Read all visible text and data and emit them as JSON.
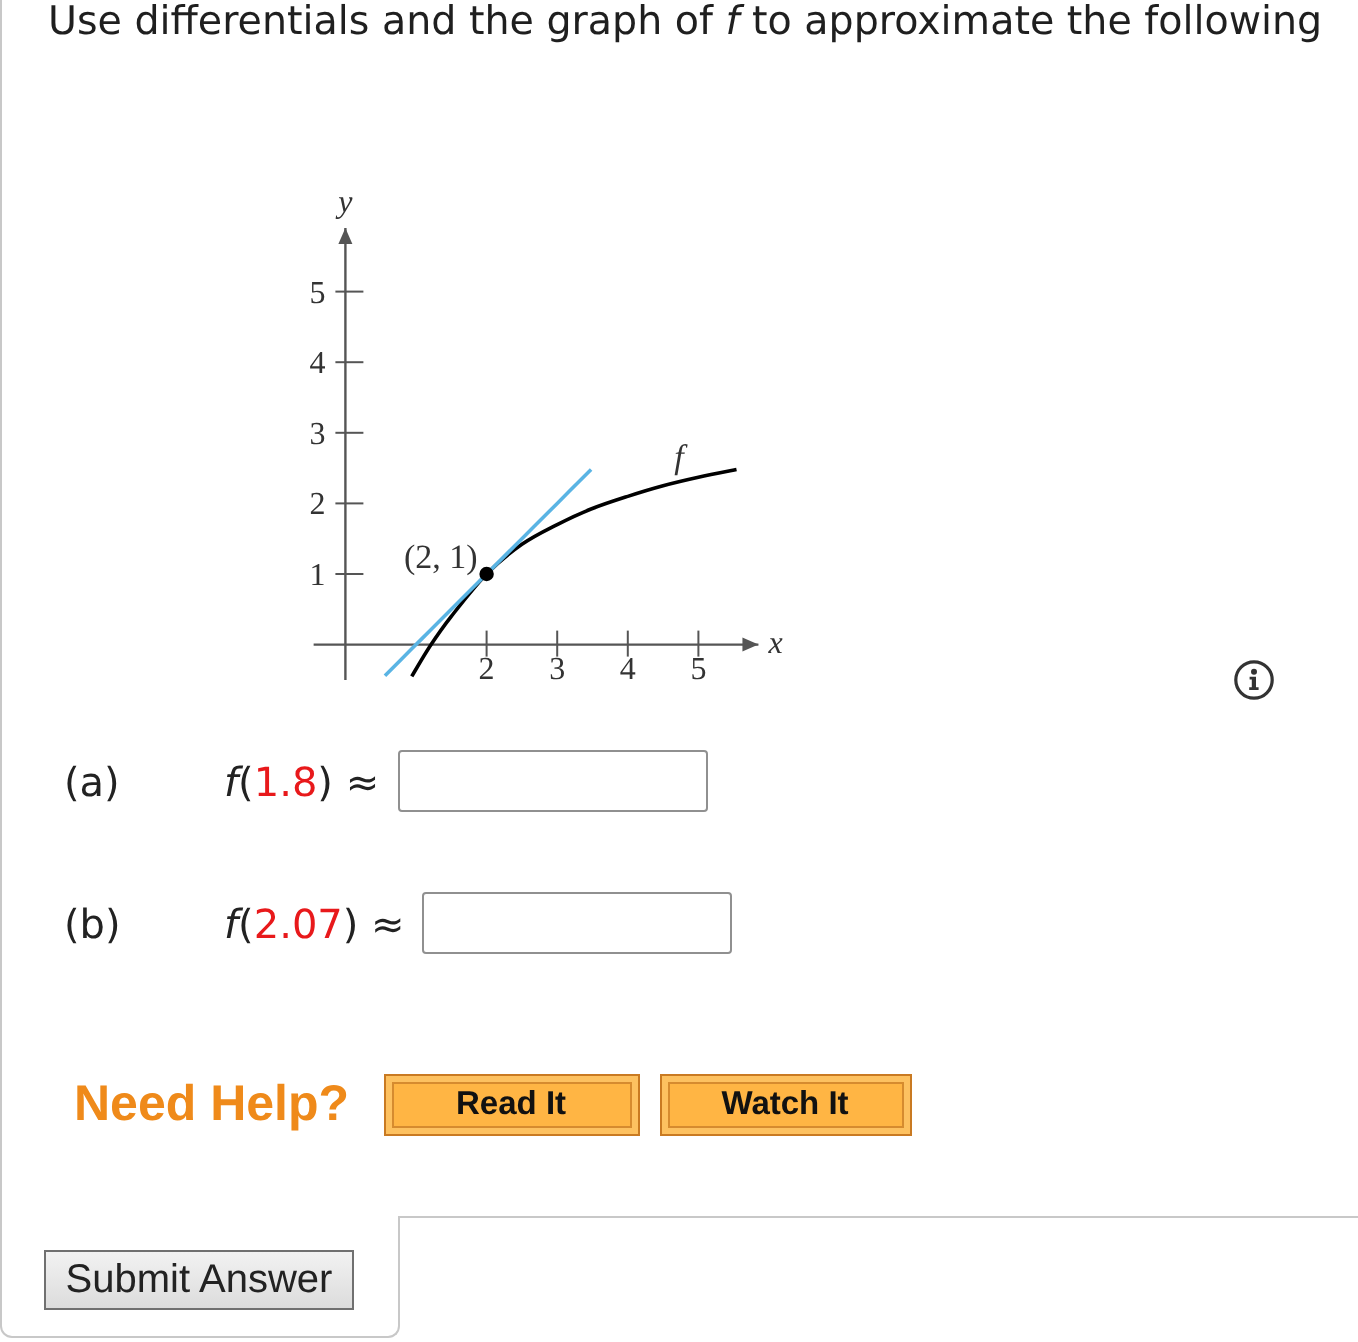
{
  "question": {
    "prompt": "Use differentials and the graph of *f* to approximate the following"
  },
  "figure": {
    "chart_data": {
      "type": "line",
      "xlabel": "x",
      "ylabel": "y",
      "x": [
        0.56,
        0.94,
        1.2,
        1.5,
        2,
        2.5,
        3,
        3.48,
        4,
        4.5,
        5,
        5.54
      ],
      "series": [
        {
          "color": "#000000",
          "values": [
            null,
            -0.45,
            -0.02,
            0.4,
            1,
            1.42,
            1.7,
            1.92,
            2.1,
            2.25,
            2.37,
            2.48
          ]
        },
        {
          "color": "#5ab4e4",
          "values": [
            -0.44,
            -0.06,
            0.2,
            0.5,
            1,
            1.5,
            2,
            2.48,
            null,
            null,
            null,
            null
          ]
        }
      ],
      "xlim": [
        -0.45,
        5.85
      ],
      "ylim": [
        -0.5,
        5.9
      ],
      "xticks": [
        2,
        3,
        4,
        5
      ],
      "yticks": [
        1,
        2,
        3,
        4,
        5
      ],
      "annotations": [
        {
          "text": "(2, 1)",
          "x": 2,
          "y": 1
        },
        "f"
      ]
    }
  },
  "parts": [
    {
      "label": "(a)",
      "expression_start": "*f*(",
      "argument": "1.8",
      "expression_end": ") ≈"
    },
    {
      "label": "(b)",
      "expression_start": "*f*(",
      "argument": "2.07",
      "expression_end": ") ≈"
    }
  ],
  "help": {
    "title": "Need Help?",
    "buttons": [
      "Read It",
      "Watch It"
    ]
  },
  "submit": {
    "label": "Submit Answer"
  }
}
